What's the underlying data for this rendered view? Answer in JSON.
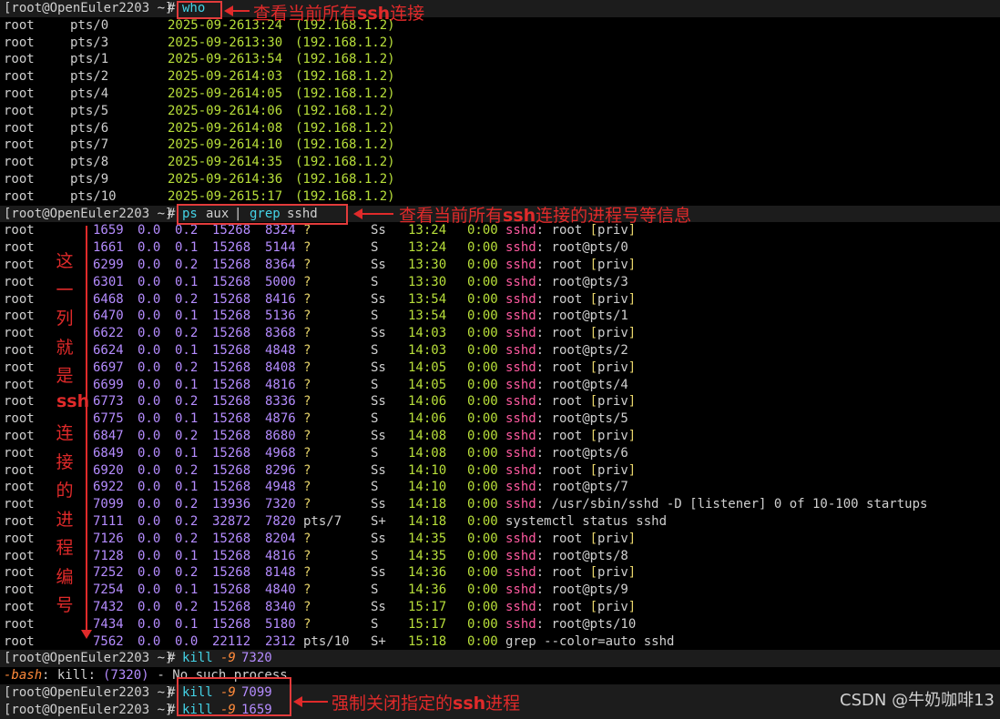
{
  "prompt": "[root@OpenEuler2203 ~]",
  "cmd_who": "who",
  "who_rows": [
    {
      "user": "root",
      "tty": "pts/0",
      "date": "2025-09-26",
      "time": "13:24",
      "host": "(192.168.1.2)"
    },
    {
      "user": "root",
      "tty": "pts/3",
      "date": "2025-09-26",
      "time": "13:30",
      "host": "(192.168.1.2)"
    },
    {
      "user": "root",
      "tty": "pts/1",
      "date": "2025-09-26",
      "time": "13:54",
      "host": "(192.168.1.2)"
    },
    {
      "user": "root",
      "tty": "pts/2",
      "date": "2025-09-26",
      "time": "14:03",
      "host": "(192.168.1.2)"
    },
    {
      "user": "root",
      "tty": "pts/4",
      "date": "2025-09-26",
      "time": "14:05",
      "host": "(192.168.1.2)"
    },
    {
      "user": "root",
      "tty": "pts/5",
      "date": "2025-09-26",
      "time": "14:06",
      "host": "(192.168.1.2)"
    },
    {
      "user": "root",
      "tty": "pts/6",
      "date": "2025-09-26",
      "time": "14:08",
      "host": "(192.168.1.2)"
    },
    {
      "user": "root",
      "tty": "pts/7",
      "date": "2025-09-26",
      "time": "14:10",
      "host": "(192.168.1.2)"
    },
    {
      "user": "root",
      "tty": "pts/8",
      "date": "2025-09-26",
      "time": "14:35",
      "host": "(192.168.1.2)"
    },
    {
      "user": "root",
      "tty": "pts/9",
      "date": "2025-09-26",
      "time": "14:36",
      "host": "(192.168.1.2)"
    },
    {
      "user": "root",
      "tty": "pts/10",
      "date": "2025-09-26",
      "time": "15:17",
      "host": "(192.168.1.2)"
    }
  ],
  "cmd_ps": {
    "ps": "ps",
    "args": "aux",
    "pipe": "|",
    "grep": "grep",
    "pattern": "sshd"
  },
  "ps_rows": [
    {
      "user": "root",
      "pid": "1659",
      "cpu": "0.0",
      "mem": "0.2",
      "vsz": "15268",
      "rss": "8324",
      "tty": "?",
      "stat": "Ss",
      "start": "13:24",
      "time": "0:00",
      "cmd_hl": "sshd",
      "cmd_rest": ": root ",
      "b1": "[",
      "priv": "priv",
      "b2": "]"
    },
    {
      "user": "root",
      "pid": "1661",
      "cpu": "0.0",
      "mem": "0.1",
      "vsz": "15268",
      "rss": "5144",
      "tty": "?",
      "stat": "S",
      "start": "13:24",
      "time": "0:00",
      "cmd_hl": "sshd",
      "cmd_rest": ": root@pts/0",
      "b1": "",
      "priv": "",
      "b2": ""
    },
    {
      "user": "root",
      "pid": "6299",
      "cpu": "0.0",
      "mem": "0.2",
      "vsz": "15268",
      "rss": "8364",
      "tty": "?",
      "stat": "Ss",
      "start": "13:30",
      "time": "0:00",
      "cmd_hl": "sshd",
      "cmd_rest": ": root ",
      "b1": "[",
      "priv": "priv",
      "b2": "]"
    },
    {
      "user": "root",
      "pid": "6301",
      "cpu": "0.0",
      "mem": "0.1",
      "vsz": "15268",
      "rss": "5000",
      "tty": "?",
      "stat": "S",
      "start": "13:30",
      "time": "0:00",
      "cmd_hl": "sshd",
      "cmd_rest": ": root@pts/3",
      "b1": "",
      "priv": "",
      "b2": ""
    },
    {
      "user": "root",
      "pid": "6468",
      "cpu": "0.0",
      "mem": "0.2",
      "vsz": "15268",
      "rss": "8416",
      "tty": "?",
      "stat": "Ss",
      "start": "13:54",
      "time": "0:00",
      "cmd_hl": "sshd",
      "cmd_rest": ": root ",
      "b1": "[",
      "priv": "priv",
      "b2": "]"
    },
    {
      "user": "root",
      "pid": "6470",
      "cpu": "0.0",
      "mem": "0.1",
      "vsz": "15268",
      "rss": "5136",
      "tty": "?",
      "stat": "S",
      "start": "13:54",
      "time": "0:00",
      "cmd_hl": "sshd",
      "cmd_rest": ": root@pts/1",
      "b1": "",
      "priv": "",
      "b2": ""
    },
    {
      "user": "root",
      "pid": "6622",
      "cpu": "0.0",
      "mem": "0.2",
      "vsz": "15268",
      "rss": "8368",
      "tty": "?",
      "stat": "Ss",
      "start": "14:03",
      "time": "0:00",
      "cmd_hl": "sshd",
      "cmd_rest": ": root ",
      "b1": "[",
      "priv": "priv",
      "b2": "]"
    },
    {
      "user": "root",
      "pid": "6624",
      "cpu": "0.0",
      "mem": "0.1",
      "vsz": "15268",
      "rss": "4848",
      "tty": "?",
      "stat": "S",
      "start": "14:03",
      "time": "0:00",
      "cmd_hl": "sshd",
      "cmd_rest": ": root@pts/2",
      "b1": "",
      "priv": "",
      "b2": ""
    },
    {
      "user": "root",
      "pid": "6697",
      "cpu": "0.0",
      "mem": "0.2",
      "vsz": "15268",
      "rss": "8408",
      "tty": "?",
      "stat": "Ss",
      "start": "14:05",
      "time": "0:00",
      "cmd_hl": "sshd",
      "cmd_rest": ": root ",
      "b1": "[",
      "priv": "priv",
      "b2": "]"
    },
    {
      "user": "root",
      "pid": "6699",
      "cpu": "0.0",
      "mem": "0.1",
      "vsz": "15268",
      "rss": "4816",
      "tty": "?",
      "stat": "S",
      "start": "14:05",
      "time": "0:00",
      "cmd_hl": "sshd",
      "cmd_rest": ": root@pts/4",
      "b1": "",
      "priv": "",
      "b2": ""
    },
    {
      "user": "root",
      "pid": "6773",
      "cpu": "0.0",
      "mem": "0.2",
      "vsz": "15268",
      "rss": "8336",
      "tty": "?",
      "stat": "Ss",
      "start": "14:06",
      "time": "0:00",
      "cmd_hl": "sshd",
      "cmd_rest": ": root ",
      "b1": "[",
      "priv": "priv",
      "b2": "]"
    },
    {
      "user": "root",
      "pid": "6775",
      "cpu": "0.0",
      "mem": "0.1",
      "vsz": "15268",
      "rss": "4876",
      "tty": "?",
      "stat": "S",
      "start": "14:06",
      "time": "0:00",
      "cmd_hl": "sshd",
      "cmd_rest": ": root@pts/5",
      "b1": "",
      "priv": "",
      "b2": ""
    },
    {
      "user": "root",
      "pid": "6847",
      "cpu": "0.0",
      "mem": "0.2",
      "vsz": "15268",
      "rss": "8680",
      "tty": "?",
      "stat": "Ss",
      "start": "14:08",
      "time": "0:00",
      "cmd_hl": "sshd",
      "cmd_rest": ": root ",
      "b1": "[",
      "priv": "priv",
      "b2": "]"
    },
    {
      "user": "root",
      "pid": "6849",
      "cpu": "0.0",
      "mem": "0.1",
      "vsz": "15268",
      "rss": "4968",
      "tty": "?",
      "stat": "S",
      "start": "14:08",
      "time": "0:00",
      "cmd_hl": "sshd",
      "cmd_rest": ": root@pts/6",
      "b1": "",
      "priv": "",
      "b2": ""
    },
    {
      "user": "root",
      "pid": "6920",
      "cpu": "0.0",
      "mem": "0.2",
      "vsz": "15268",
      "rss": "8296",
      "tty": "?",
      "stat": "Ss",
      "start": "14:10",
      "time": "0:00",
      "cmd_hl": "sshd",
      "cmd_rest": ": root ",
      "b1": "[",
      "priv": "priv",
      "b2": "]"
    },
    {
      "user": "root",
      "pid": "6922",
      "cpu": "0.0",
      "mem": "0.1",
      "vsz": "15268",
      "rss": "4948",
      "tty": "?",
      "stat": "S",
      "start": "14:10",
      "time": "0:00",
      "cmd_hl": "sshd",
      "cmd_rest": ": root@pts/7",
      "b1": "",
      "priv": "",
      "b2": ""
    },
    {
      "user": "root",
      "pid": "7099",
      "cpu": "0.0",
      "mem": "0.2",
      "vsz": "13936",
      "rss": "7320",
      "tty": "?",
      "stat": "Ss",
      "start": "14:18",
      "time": "0:00",
      "cmd_hl": "sshd",
      "cmd_rest": ": /usr/sbin/",
      "b1": "",
      "priv": "",
      "b2": "",
      "extra": "sshd -D [listener] 0 of 10-100 startups"
    },
    {
      "user": "root",
      "pid": "7111",
      "cpu": "0.0",
      "mem": "0.2",
      "vsz": "32872",
      "rss": "7820",
      "tty": "pts/7",
      "stat": "S+",
      "start": "14:18",
      "time": "0:00",
      "cmd_hl": "",
      "cmd_rest": "systemctl status sshd",
      "b1": "",
      "priv": "",
      "b2": ""
    },
    {
      "user": "root",
      "pid": "7126",
      "cpu": "0.0",
      "mem": "0.2",
      "vsz": "15268",
      "rss": "8204",
      "tty": "?",
      "stat": "Ss",
      "start": "14:35",
      "time": "0:00",
      "cmd_hl": "sshd",
      "cmd_rest": ": root ",
      "b1": "[",
      "priv": "priv",
      "b2": "]"
    },
    {
      "user": "root",
      "pid": "7128",
      "cpu": "0.0",
      "mem": "0.1",
      "vsz": "15268",
      "rss": "4816",
      "tty": "?",
      "stat": "S",
      "start": "14:35",
      "time": "0:00",
      "cmd_hl": "sshd",
      "cmd_rest": ": root@pts/8",
      "b1": "",
      "priv": "",
      "b2": ""
    },
    {
      "user": "root",
      "pid": "7252",
      "cpu": "0.0",
      "mem": "0.2",
      "vsz": "15268",
      "rss": "8148",
      "tty": "?",
      "stat": "Ss",
      "start": "14:36",
      "time": "0:00",
      "cmd_hl": "sshd",
      "cmd_rest": ": root ",
      "b1": "[",
      "priv": "priv",
      "b2": "]"
    },
    {
      "user": "root",
      "pid": "7254",
      "cpu": "0.0",
      "mem": "0.1",
      "vsz": "15268",
      "rss": "4840",
      "tty": "?",
      "stat": "S",
      "start": "14:36",
      "time": "0:00",
      "cmd_hl": "sshd",
      "cmd_rest": ": root@pts/9",
      "b1": "",
      "priv": "",
      "b2": ""
    },
    {
      "user": "root",
      "pid": "7432",
      "cpu": "0.0",
      "mem": "0.2",
      "vsz": "15268",
      "rss": "8340",
      "tty": "?",
      "stat": "Ss",
      "start": "15:17",
      "time": "0:00",
      "cmd_hl": "sshd",
      "cmd_rest": ": root ",
      "b1": "[",
      "priv": "priv",
      "b2": "]"
    },
    {
      "user": "root",
      "pid": "7434",
      "cpu": "0.0",
      "mem": "0.1",
      "vsz": "15268",
      "rss": "5180",
      "tty": "?",
      "stat": "S",
      "start": "15:17",
      "time": "0:00",
      "cmd_hl": "sshd",
      "cmd_rest": ": root@pts/10",
      "b1": "",
      "priv": "",
      "b2": ""
    },
    {
      "user": "root",
      "pid": "7562",
      "cpu": "0.0",
      "mem": "0.0",
      "vsz": "22112",
      "rss": "2312",
      "tty": "pts/10",
      "stat": "S+",
      "start": "15:18",
      "time": "0:00",
      "cmd_hl": "",
      "cmd_rest": "grep --color=auto sshd",
      "b1": "",
      "priv": "",
      "b2": ""
    }
  ],
  "kill_cmds": [
    {
      "kill": "kill",
      "flag": "-9",
      "pid": "7320"
    },
    {
      "kill": "kill",
      "flag": "-9",
      "pid": "7099"
    },
    {
      "kill": "kill",
      "flag": "-9",
      "pid": "1659"
    }
  ],
  "error_line": {
    "bash": "-bash",
    "sep": ": kill: ",
    "paren": "(7320)",
    "msg": " - No such process"
  },
  "annotations": {
    "who_note_pre": "查看当前所有",
    "who_note_bold": "ssh",
    "who_note_post": "连接",
    "ps_note_pre": "查看当前所有",
    "ps_note_bold": "ssh",
    "ps_note_post": "连接的进程号等信息",
    "pid_col_note": [
      "这",
      "一",
      "列",
      "就",
      "是",
      "ssh",
      "连",
      "接",
      "的",
      "进",
      "程",
      "编",
      "号"
    ],
    "kill_note_pre": "强制关闭指定的",
    "kill_note_bold": "ssh",
    "kill_note_post": "进程"
  },
  "watermark": "CSDN @牛奶咖啡13"
}
